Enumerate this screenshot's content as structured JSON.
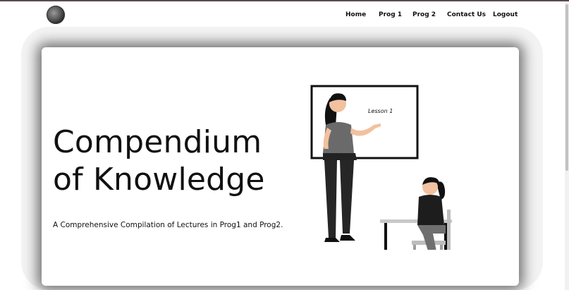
{
  "nav": {
    "links": [
      "Home",
      "Prog 1",
      "Prog 2",
      "Contact Us",
      "Logout"
    ]
  },
  "hero": {
    "title_line1": "Compendium",
    "title_line2": "of Knowledge",
    "subtitle": "A Comprehensive Compilation of Lectures in Prog1 and Prog2.",
    "board_text": "Lesson 1"
  }
}
